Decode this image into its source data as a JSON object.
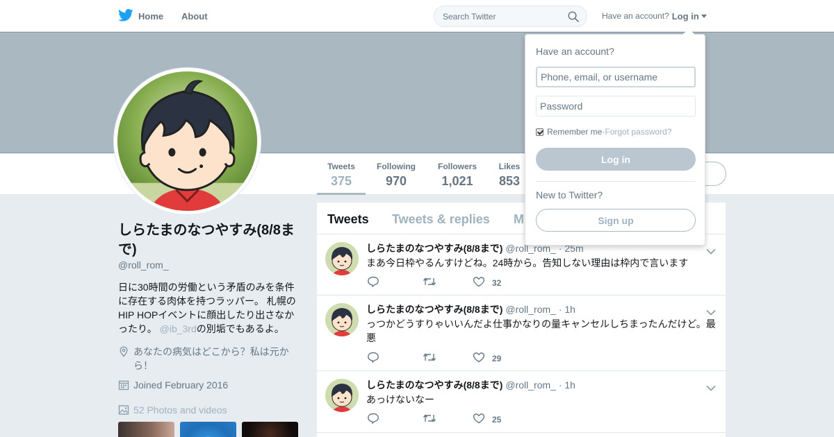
{
  "nav": {
    "home_label": "Home",
    "about_label": "About",
    "search_placeholder": "Search Twitter",
    "have_account": "Have an account?",
    "login_label": "Log in"
  },
  "profile_nav": {
    "stats": [
      {
        "label": "Tweets",
        "value": "375"
      },
      {
        "label": "Following",
        "value": "970"
      },
      {
        "label": "Followers",
        "value": "1,021"
      },
      {
        "label": "Likes",
        "value": "853"
      }
    ]
  },
  "profile": {
    "name": "しらたまのなつやすみ(8/8まで)",
    "handle": "@roll_rom_",
    "bio_text": "日に30時間の労働という矛盾のみを条件に存在する肉体を持つラッパー。 札幌のHIP HOPイベントに顔出したり出さなかったり。",
    "bio_mention": "@ib_3rd",
    "bio_tail": "の別垢でもあるよ。",
    "location": "あなたの病気はどこから？私は元から！",
    "joined": "Joined February 2016",
    "photos": "52 Photos and videos"
  },
  "timeline": {
    "tabs": [
      "Tweets",
      "Tweets & replies",
      "M"
    ],
    "tweets": [
      {
        "name": "しらたまのなつやすみ(8/8まで)",
        "handle": "@roll_rom_",
        "time": " · 25m",
        "text": "まあ今日枠やるんすけどね。24時から。告知しない理由は枠内で言います",
        "likes": "32"
      },
      {
        "name": "しらたまのなつやすみ(8/8まで)",
        "handle": "@roll_rom_",
        "time": " · 1h",
        "text": "っつかどうすりゃいいんだよ仕事かなりの量キャンセルしちまったんだけど。最悪",
        "likes": "29"
      },
      {
        "name": "しらたまのなつやすみ(8/8まで)",
        "handle": "@roll_rom_",
        "time": " · 1h",
        "text": "あっけないなー",
        "likes": "25"
      }
    ]
  },
  "login_dropdown": {
    "title": "Have an account?",
    "username_placeholder": "Phone, email, or username",
    "password_placeholder": "Password",
    "remember_label": "Remember me",
    "separator": " · ",
    "forgot_label": "Forgot password?",
    "login_button": "Log in",
    "new_label": "New to Twitter?",
    "signup_button": "Sign up"
  },
  "colors": {
    "banner": "#aab8c2",
    "twitter_blue": "#1da1f2",
    "muted": "#657786"
  }
}
